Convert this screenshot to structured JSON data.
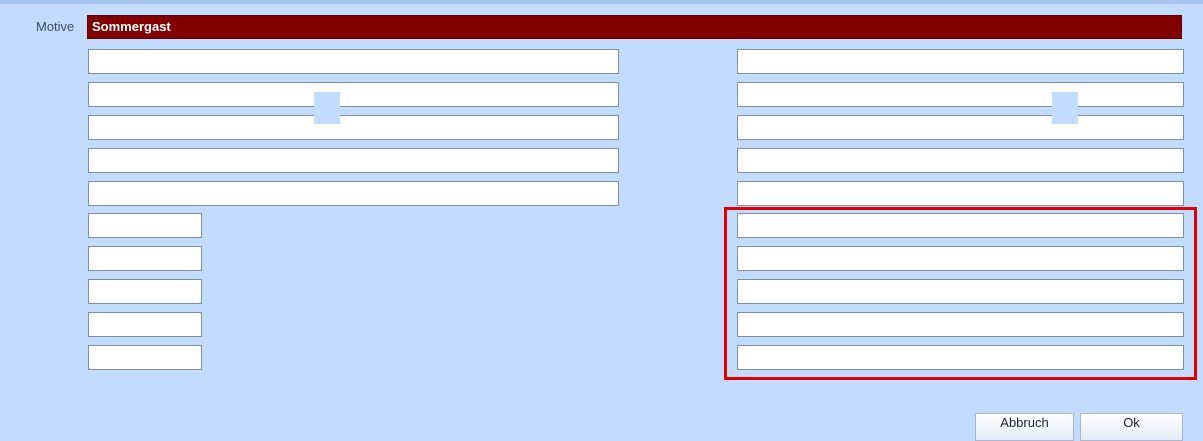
{
  "header": {
    "motive_label": "Motive",
    "motive_value": "Sommergast"
  },
  "fields": {
    "left_wide": [
      "",
      "",
      "",
      "",
      ""
    ],
    "left_narrow": [
      "",
      "",
      "",
      "",
      ""
    ],
    "right": [
      "",
      "",
      "",
      "",
      "",
      "",
      "",
      "",
      "",
      ""
    ]
  },
  "buttons": {
    "cancel": "Abbruch",
    "ok": "Ok"
  },
  "colors": {
    "background": "#c3dbff",
    "motive_bar": "#800000",
    "highlight": "#e00000"
  }
}
